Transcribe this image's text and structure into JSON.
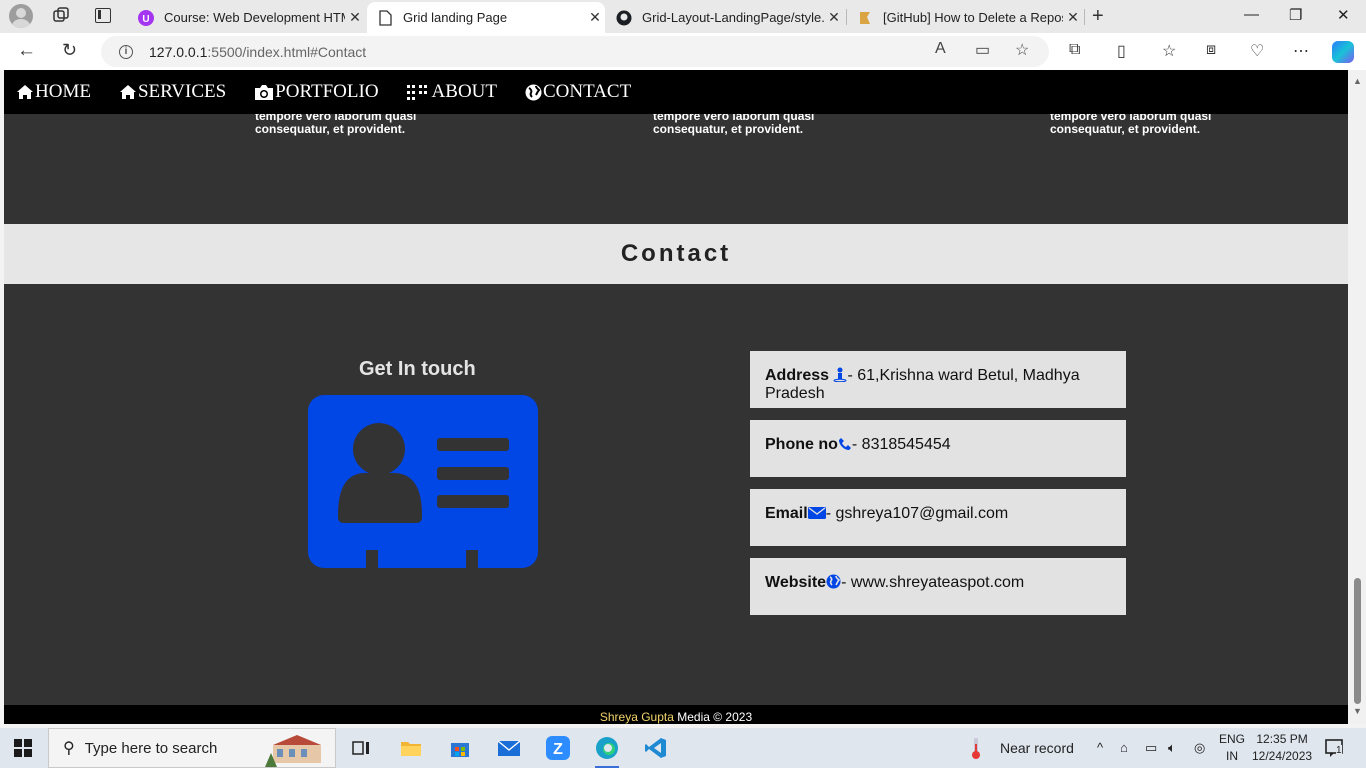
{
  "browser": {
    "tabs": [
      {
        "title": "Course: Web Development HTML",
        "favicon": "udemy-icon",
        "active": false
      },
      {
        "title": "Grid landing Page",
        "favicon": "page-icon",
        "active": true
      },
      {
        "title": "Grid-Layout-LandingPage/style.c",
        "favicon": "github-icon",
        "active": false
      },
      {
        "title": "[GitHub] How to Delete a Reposit",
        "favicon": "article-icon",
        "active": false
      }
    ],
    "close_glyph": "✕",
    "new_tab_glyph": "+",
    "window_controls": {
      "minimize": "—",
      "restore": "❐",
      "close": "✕"
    },
    "url_host": "127.0.0.1",
    "url_rest": ":5500/index.html#Contact"
  },
  "page": {
    "nav": [
      {
        "label": "HOME",
        "icon": "home-icon"
      },
      {
        "label": "SERVICES",
        "icon": "home-icon"
      },
      {
        "label": "PORTFOLIO",
        "icon": "camera-icon"
      },
      {
        "label": "ABOUT",
        "icon": "grid-icon"
      },
      {
        "label": "CONTACT",
        "icon": "globe-icon"
      }
    ],
    "previous_section": {
      "line1": "tempore vero laborum quasi",
      "line2": "consequatur, et provident."
    },
    "contact_title": "Contact",
    "get_in_touch": "Get In touch",
    "info": {
      "address": {
        "label": "Address",
        "value": "- 61,Krishna ward Betul, Madhya Pradesh"
      },
      "phone": {
        "label": "Phone no",
        "value": "- 8318545454"
      },
      "email": {
        "label": "Email",
        "value": "- gshreya107@gmail.com"
      },
      "website": {
        "label": "Website",
        "value": "- www.shreyateaspot.com"
      }
    },
    "footer": {
      "name": "Shreya Gupta",
      "rest": " Media © 2023"
    },
    "accent_color": "#0047e6"
  },
  "taskbar": {
    "search_placeholder": "Type here to search",
    "weather": "Near record",
    "language": {
      "line1": "ENG",
      "line2": "IN"
    },
    "time": "12:35 PM",
    "date": "12/24/2023",
    "notification_count": "1"
  }
}
